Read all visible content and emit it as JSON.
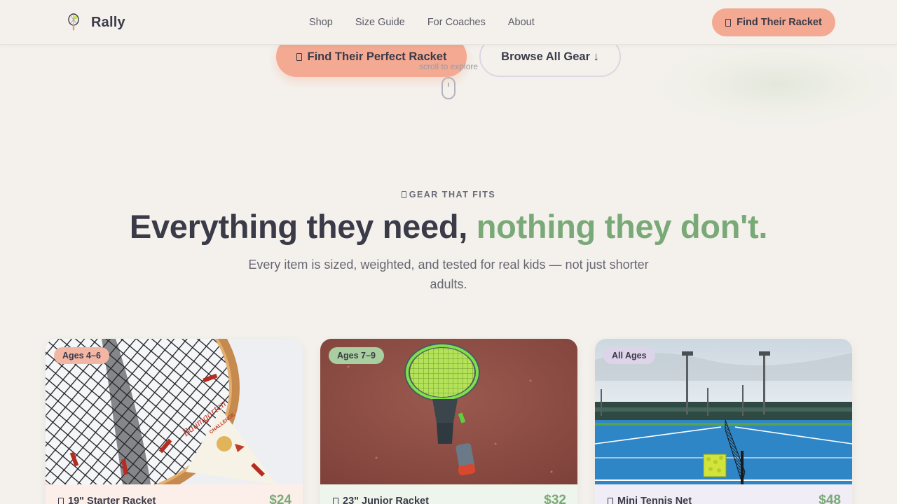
{
  "nav": {
    "brand": "Rally",
    "links": [
      "Shop",
      "Size Guide",
      "For Coaches",
      "About"
    ],
    "cta_label": "Find Their Racket"
  },
  "hero": {
    "primary_label": "Find Their Perfect Racket",
    "secondary_label": "Browse All Gear ↓",
    "scroll_hint": "scroll to explore"
  },
  "section": {
    "eyebrow": "GEAR THAT FITS",
    "headline_main": "Everything they need, ",
    "headline_accent": "nothing they don't.",
    "subtext": "Every item is sized, weighted, and tested for real kids — not just shorter adults."
  },
  "products": [
    {
      "badge": "Ages 4–6",
      "title": "19\" Starter Racket",
      "price": "$24",
      "badge_color": "#f3b6a4",
      "body_color": "#fcefea"
    },
    {
      "badge": "Ages 7–9",
      "title": "23\" Junior Racket",
      "price": "$32",
      "badge_color": "#a9cfa0",
      "body_color": "#eef5ec"
    },
    {
      "badge": "All Ages",
      "title": "Mini Tennis Net",
      "price": "$48",
      "badge_color": "#ddd4ea",
      "body_color": "#f1edf6"
    }
  ],
  "colors": {
    "background": "#f4f1ec",
    "coral": "#f3a992",
    "sage": "#7aa978",
    "ink": "#3a3a48"
  }
}
